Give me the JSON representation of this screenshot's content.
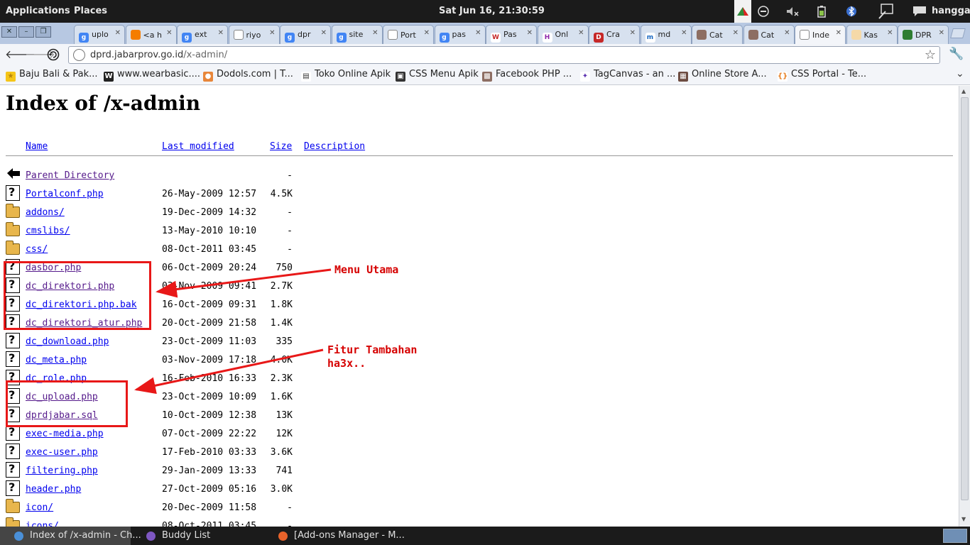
{
  "panel": {
    "applications": "Applications",
    "places": "Places",
    "clock": "Sat Jun 16, 21:30:59",
    "user": "hangga"
  },
  "tabs": [
    {
      "label": "uplo",
      "fav": "google"
    },
    {
      "label": "<a h",
      "fav": "blogger"
    },
    {
      "label": "ext",
      "fav": "google"
    },
    {
      "label": "riyo",
      "fav": "spinner"
    },
    {
      "label": "dpr",
      "fav": "google"
    },
    {
      "label": "site",
      "fav": "google"
    },
    {
      "label": "Port",
      "fav": "doc"
    },
    {
      "label": "pas",
      "fav": "google"
    },
    {
      "label": "Pas",
      "fav": "w"
    },
    {
      "label": "Onl",
      "fav": "h"
    },
    {
      "label": "Cra",
      "fav": "d"
    },
    {
      "label": "md",
      "fav": "m"
    },
    {
      "label": "Cat",
      "fav": "person"
    },
    {
      "label": "Cat",
      "fav": "person"
    },
    {
      "label": "Inde",
      "fav": "doc",
      "active": true
    },
    {
      "label": "Kas",
      "fav": "kas"
    },
    {
      "label": "DPR",
      "fav": "dpr"
    }
  ],
  "toolbar": {
    "url_host": "dprd.jabarprov.go.id",
    "url_path": "/x-admin/"
  },
  "bookmarks": [
    {
      "label": "Baju Bali & Pak...",
      "icon": "star-icon"
    },
    {
      "label": "www.wearbasic....",
      "icon": "w-icon"
    },
    {
      "label": "Dodols.com | T...",
      "icon": "dodols-icon"
    },
    {
      "label": "Toko Online Apik",
      "icon": "page-icon"
    },
    {
      "label": "CSS Menu Apik",
      "icon": "css-icon"
    },
    {
      "label": "Facebook PHP ...",
      "icon": "photo-icon"
    },
    {
      "label": "TagCanvas - an ...",
      "icon": "tagcanvas-icon"
    },
    {
      "label": "Online Store A...",
      "icon": "store-icon"
    },
    {
      "label": "CSS Portal - Te...",
      "icon": "cssportal-icon"
    }
  ],
  "page": {
    "title": "Index of /x-admin",
    "headers": {
      "name": "Name",
      "last_modified": "Last modified",
      "size": "Size",
      "description": "Description"
    },
    "rows": [
      {
        "name": "Parent Directory",
        "date": "",
        "size": "-",
        "icon": "back",
        "visited": true
      },
      {
        "name": "Portalconf.php",
        "date": "26-May-2009 12:57",
        "size": "4.5K",
        "icon": "file"
      },
      {
        "name": "addons/",
        "date": "19-Dec-2009 14:32",
        "size": "-",
        "icon": "folder"
      },
      {
        "name": "cmslibs/",
        "date": "13-May-2010 10:10",
        "size": "-",
        "icon": "folder"
      },
      {
        "name": "css/",
        "date": "08-Oct-2011 03:45",
        "size": "-",
        "icon": "folder"
      },
      {
        "name": "dasbor.php",
        "date": "06-Oct-2009 20:24",
        "size": "750",
        "icon": "file",
        "visited": true
      },
      {
        "name": "dc_direktori.php",
        "date": "03-Nov-2009 09:41",
        "size": "2.7K",
        "icon": "file",
        "visited": true
      },
      {
        "name": "dc_direktori.php.bak",
        "date": "16-Oct-2009 09:31",
        "size": "1.8K",
        "icon": "file"
      },
      {
        "name": "dc_direktori_atur.php",
        "date": "20-Oct-2009 21:58",
        "size": "1.4K",
        "icon": "file",
        "visited": true
      },
      {
        "name": "dc_download.php",
        "date": "23-Oct-2009 11:03",
        "size": "335",
        "icon": "file"
      },
      {
        "name": "dc_meta.php",
        "date": "03-Nov-2009 17:18",
        "size": "4.0K",
        "icon": "file"
      },
      {
        "name": "dc_role.php",
        "date": "16-Feb-2010 16:33",
        "size": "2.3K",
        "icon": "file"
      },
      {
        "name": "dc_upload.php",
        "date": "23-Oct-2009 10:09",
        "size": "1.6K",
        "icon": "file",
        "visited": true
      },
      {
        "name": "dprdjabar.sql",
        "date": "10-Oct-2009 12:38",
        "size": "13K",
        "icon": "file",
        "visited": true
      },
      {
        "name": "exec-media.php",
        "date": "07-Oct-2009 22:22",
        "size": "12K",
        "icon": "file"
      },
      {
        "name": "exec-user.php",
        "date": "17-Feb-2010 03:33",
        "size": "3.6K",
        "icon": "file"
      },
      {
        "name": "filtering.php",
        "date": "29-Jan-2009 13:33",
        "size": "741",
        "icon": "file"
      },
      {
        "name": "header.php",
        "date": "27-Oct-2009 05:16",
        "size": "3.0K",
        "icon": "file"
      },
      {
        "name": "icon/",
        "date": "20-Dec-2009 11:58",
        "size": "-",
        "icon": "folder"
      },
      {
        "name": "icons/",
        "date": "08-Oct-2011 03:45",
        "size": "-",
        "icon": "folder"
      }
    ]
  },
  "annotations": {
    "menu_utama": "Menu Utama",
    "fitur_tambahan": "Fitur Tambahan\nha3x..",
    "color": "#e81818"
  },
  "taskbar": [
    {
      "label": "Index of /x-admin - Ch...",
      "active": true
    },
    {
      "label": "Buddy List"
    },
    {
      "label": "[Add-ons Manager - M..."
    }
  ]
}
